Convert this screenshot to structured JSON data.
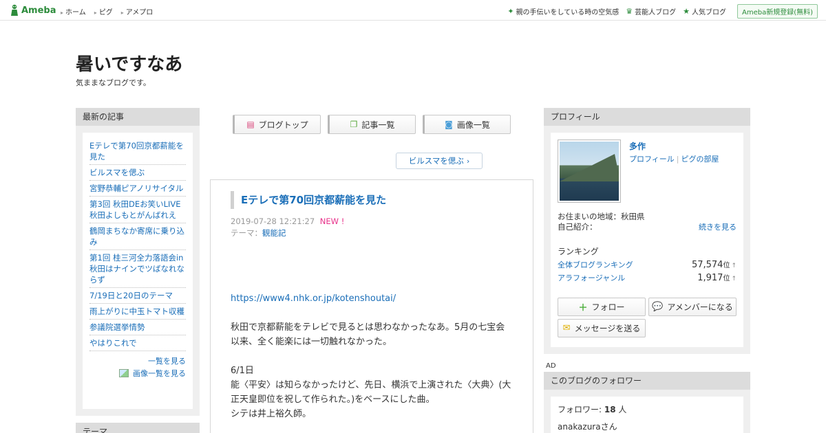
{
  "header": {
    "logo": "Ameba",
    "nav_left": [
      "ホーム",
      "ピグ",
      "アメプロ"
    ],
    "nav_right": [
      {
        "icon": "sparkle-icon",
        "label": "親の手伝いをしている時の空気感"
      },
      {
        "icon": "crown-icon",
        "label": "芸能人ブログ"
      },
      {
        "icon": "star-icon",
        "label": "人気ブログ"
      }
    ],
    "register": "Ameba新規登録(無料)"
  },
  "blog": {
    "title": "暑いですなあ",
    "description": "気ままなブログです。"
  },
  "left": {
    "heading": "最新の記事",
    "articles": [
      "Eテレで第70回京都薪能を見た",
      "ビルスマを偲ぶ",
      "宮野恭輔ピアノリサイタル",
      "第3回 秋田DEお笑いLIVE 秋田よしもとがんばれえ",
      "鶴岡まちなか寄席に乗り込み",
      "第1回 桂三河全力落語会in秋田はナインでツばなれならず",
      "7/19日と20日のテーマ",
      "雨上がりに中玉トマト収穫",
      "参議院選挙情勢",
      "やはりこれで"
    ],
    "more_articles": "一覧を見る",
    "more_images": "画像一覧を見る",
    "heading2": "テーマ"
  },
  "center": {
    "tabs": [
      {
        "icon": "list-icon",
        "label": "ブログトップ"
      },
      {
        "icon": "copy-icon",
        "label": "記事一覧"
      },
      {
        "icon": "camera-icon",
        "label": "画像一覧"
      }
    ],
    "prev_link": "ビルスマを偲ぶ",
    "article": {
      "title": "Eテレで第70回京都薪能を見た",
      "datetime": "2019-07-28 12:21:27",
      "new_badge": "NEW !",
      "theme_label": "テーマ：",
      "theme": "観能記",
      "url": "https://www4.nhk.or.jp/kotenshoutai/",
      "para1": "秋田で京都薪能をテレビで見るとは思わなかったなあ。5月の七宝会以来、全く能楽には一切触れなかった。",
      "line_date": "6/1日",
      "line2": "能〈平安〉は知らなかったけど、先日、横浜で上演された〈大典〉(大正天皇即位を祝して作られた。)をベースにした曲。",
      "line3": "シテは井上裕久師。"
    }
  },
  "right": {
    "heading": "プロフィール",
    "name": "多作",
    "link_profile": "プロフィール",
    "link_pig": "ピグの部屋",
    "location": "お住まいの地域：秋田県",
    "intro": "自己紹介：",
    "intro_more": "続きを見る",
    "ranking_label": "ランキング",
    "ranking": [
      {
        "label": "全体ブログランキング",
        "value": "57,574",
        "unit": "位"
      },
      {
        "label": "アラフォージャンル",
        "value": "1,917",
        "unit": "位"
      }
    ],
    "follow": "フォロー",
    "member": "アメンバーになる",
    "message": "メッセージを送る",
    "ad": "AD",
    "heading2": "このブログのフォロワー",
    "followers_label": "フォロワー: ",
    "followers_count": "18",
    "followers_unit": " 人",
    "follower_name": "anakazuraさん"
  },
  "colors": {
    "link": "#1a6eb8",
    "brand": "#2d8c3c",
    "new": "#e8318a"
  }
}
